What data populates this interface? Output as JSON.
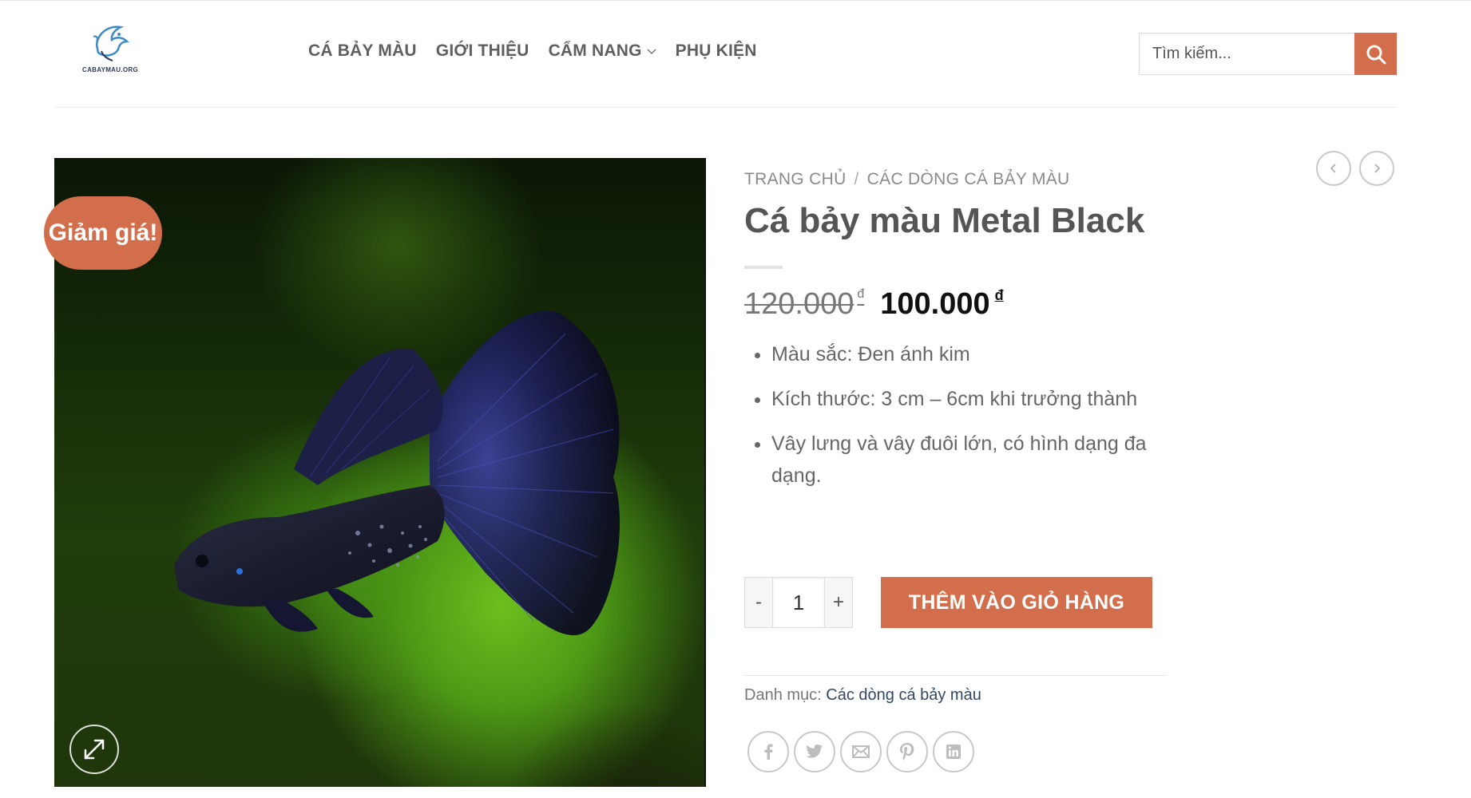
{
  "header": {
    "logo_text": "CABAYMAU.ORG",
    "nav": [
      {
        "label": "CÁ BẢY MÀU"
      },
      {
        "label": "GIỚI THIỆU"
      },
      {
        "label": "CẨM NANG"
      },
      {
        "label": "PHỤ KIỆN"
      }
    ],
    "search_placeholder": "Tìm kiếm..."
  },
  "product": {
    "sale_badge": "Giảm giá!",
    "breadcrumb": {
      "home": "TRANG CHỦ",
      "separator": "/",
      "category": "CÁC DÒNG CÁ BẢY MÀU"
    },
    "title": "Cá bảy màu Metal Black",
    "old_price": "120.000",
    "new_price": "100.000",
    "currency": "đ",
    "features": [
      "Màu sắc: Đen ánh kim",
      "Kích thước: 3 cm – 6cm khi trưởng thành",
      "Vây lưng và vây đuôi lớn, có hình dạng đa dạng."
    ],
    "quantity": "1",
    "qty_minus": "-",
    "qty_plus": "+",
    "add_to_cart": "THÊM VÀO GIỎ HÀNG",
    "category_label": "Danh mục:",
    "category_link": "Các dòng cá bảy màu"
  },
  "icons": {
    "search": "search-icon",
    "zoom": "expand-icon",
    "share": [
      "facebook-icon",
      "twitter-icon",
      "email-icon",
      "pinterest-icon",
      "linkedin-icon"
    ],
    "arrows": [
      "chevron-left-icon",
      "chevron-right-icon"
    ]
  },
  "colors": {
    "accent": "#d26e4b",
    "link": "#334862"
  }
}
